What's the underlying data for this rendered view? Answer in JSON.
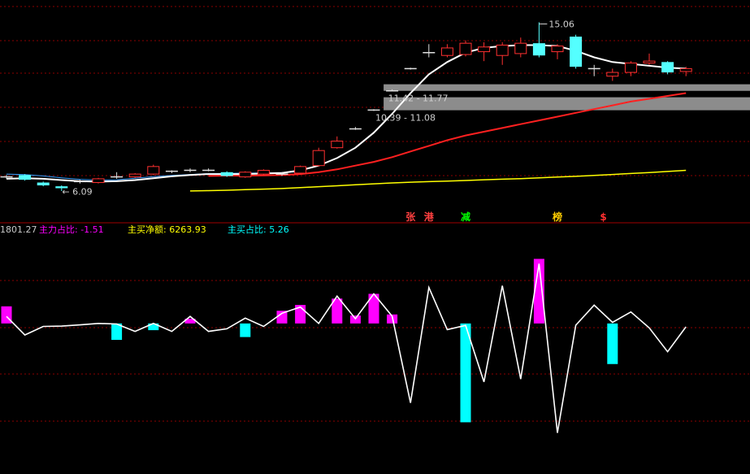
{
  "chart_data": [
    {
      "type": "candlestick",
      "price_ylim": [
        4.5,
        15.9
      ],
      "annotations": {
        "high_label": "15.06",
        "low_label": "6.09",
        "zone_upper_label": "11.42 - 11.77",
        "zone_lower_label": "10.39 - 11.08"
      },
      "zones": [
        {
          "low": 11.42,
          "high": 11.77
        },
        {
          "low": 10.39,
          "high": 11.08
        }
      ],
      "event_markers": [
        {
          "text": "张",
          "color": "#ff4040"
        },
        {
          "text": "港",
          "color": "#ff4040"
        },
        {
          "text": "减",
          "color": "#00ff00"
        },
        {
          "text": "榜",
          "color": "#ffcc00"
        },
        {
          "text": "$",
          "color": "#ff3030"
        }
      ],
      "candles": [
        {
          "o": 6.85,
          "c": 6.85,
          "h": 6.95,
          "l": 6.75,
          "up": true
        },
        {
          "o": 6.95,
          "c": 6.7,
          "h": 7.0,
          "l": 6.65,
          "up": false
        },
        {
          "o": 6.55,
          "c": 6.4,
          "h": 6.6,
          "l": 6.35,
          "up": false
        },
        {
          "o": 6.35,
          "c": 6.25,
          "h": 6.4,
          "l": 6.1,
          "up": false
        },
        {
          "o": 6.6,
          "c": 6.6,
          "h": 6.7,
          "l": 6.5,
          "up": true
        },
        {
          "o": 6.55,
          "c": 6.75,
          "h": 6.8,
          "l": 6.5,
          "up": true
        },
        {
          "o": 6.8,
          "c": 6.85,
          "h": 7.1,
          "l": 6.75,
          "up": true
        },
        {
          "o": 6.85,
          "c": 7.0,
          "h": 7.05,
          "l": 6.8,
          "up": true
        },
        {
          "o": 7.0,
          "c": 7.4,
          "h": 7.5,
          "l": 6.95,
          "up": true
        },
        {
          "o": 7.15,
          "c": 7.1,
          "h": 7.2,
          "l": 7.05,
          "up": false
        },
        {
          "o": 7.2,
          "c": 7.2,
          "h": 7.3,
          "l": 7.1,
          "up": true
        },
        {
          "o": 7.2,
          "c": 7.2,
          "h": 7.3,
          "l": 7.15,
          "up": true
        },
        {
          "o": 7.1,
          "c": 6.9,
          "h": 7.15,
          "l": 6.85,
          "up": false
        },
        {
          "o": 6.85,
          "c": 7.1,
          "h": 7.15,
          "l": 6.8,
          "up": true
        },
        {
          "o": 7.0,
          "c": 7.2,
          "h": 7.25,
          "l": 6.95,
          "up": true
        },
        {
          "o": 6.95,
          "c": 7.0,
          "h": 7.1,
          "l": 6.9,
          "up": true
        },
        {
          "o": 7.05,
          "c": 7.4,
          "h": 7.45,
          "l": 7.0,
          "up": true
        },
        {
          "o": 7.45,
          "c": 8.25,
          "h": 8.4,
          "l": 7.4,
          "up": true
        },
        {
          "o": 8.4,
          "c": 8.75,
          "h": 9.0,
          "l": 8.35,
          "up": true
        },
        {
          "o": 9.4,
          "c": 9.4,
          "h": 9.5,
          "l": 9.35,
          "up": true
        },
        {
          "o": 10.4,
          "c": 10.4,
          "h": 10.45,
          "l": 10.35,
          "up": true
        },
        {
          "o": 11.42,
          "c": 11.42,
          "h": 11.5,
          "l": 11.4,
          "up": true
        },
        {
          "o": 12.6,
          "c": 12.6,
          "h": 12.65,
          "l": 12.55,
          "up": true
        },
        {
          "o": 13.45,
          "c": 13.45,
          "h": 13.9,
          "l": 13.2,
          "up": false
        },
        {
          "o": 13.3,
          "c": 13.7,
          "h": 13.9,
          "l": 13.2,
          "up": true
        },
        {
          "o": 13.35,
          "c": 13.95,
          "h": 14.1,
          "l": 13.25,
          "up": true
        },
        {
          "o": 13.5,
          "c": 13.75,
          "h": 14.0,
          "l": 13.0,
          "up": true
        },
        {
          "o": 13.3,
          "c": 13.85,
          "h": 14.0,
          "l": 12.8,
          "up": true
        },
        {
          "o": 13.4,
          "c": 13.95,
          "h": 14.25,
          "l": 13.2,
          "up": true
        },
        {
          "o": 13.95,
          "c": 13.3,
          "h": 15.06,
          "l": 13.2,
          "up": false
        },
        {
          "o": 13.5,
          "c": 13.8,
          "h": 13.9,
          "l": 13.1,
          "up": true
        },
        {
          "o": 14.3,
          "c": 12.7,
          "h": 14.4,
          "l": 12.6,
          "up": false
        },
        {
          "o": 12.6,
          "c": 12.6,
          "h": 12.8,
          "l": 12.2,
          "up": false
        },
        {
          "o": 12.2,
          "c": 12.4,
          "h": 12.6,
          "l": 11.95,
          "up": true
        },
        {
          "o": 12.4,
          "c": 12.9,
          "h": 13.0,
          "l": 12.2,
          "up": true
        },
        {
          "o": 12.9,
          "c": 13.0,
          "h": 13.4,
          "l": 12.8,
          "up": true
        },
        {
          "o": 12.95,
          "c": 12.4,
          "h": 13.0,
          "l": 12.3,
          "up": false
        },
        {
          "o": 12.6,
          "c": 12.45,
          "h": 12.7,
          "l": 12.2,
          "up": true
        }
      ],
      "ma_white": [
        6.75,
        6.78,
        6.75,
        6.68,
        6.62,
        6.6,
        6.62,
        6.68,
        6.78,
        6.88,
        6.95,
        7.0,
        7.0,
        7.0,
        7.03,
        7.06,
        7.2,
        7.45,
        7.85,
        8.4,
        9.2,
        10.2,
        11.3,
        12.3,
        12.95,
        13.45,
        13.7,
        13.8,
        13.85,
        13.85,
        13.8,
        13.55,
        13.2,
        12.95,
        12.85,
        12.75,
        12.65,
        12.6
      ],
      "ma_red": [
        null,
        null,
        null,
        null,
        null,
        null,
        null,
        null,
        null,
        null,
        null,
        6.9,
        6.92,
        6.92,
        6.93,
        6.95,
        7.0,
        7.1,
        7.25,
        7.45,
        7.65,
        7.9,
        8.2,
        8.5,
        8.8,
        9.05,
        9.25,
        9.45,
        9.65,
        9.85,
        10.05,
        10.25,
        10.45,
        10.65,
        10.85,
        11.0,
        11.15,
        11.3
      ],
      "ma_yellow": [
        null,
        null,
        null,
        null,
        null,
        null,
        null,
        null,
        null,
        null,
        6.1,
        6.12,
        6.14,
        6.17,
        6.2,
        6.23,
        6.28,
        6.33,
        6.38,
        6.43,
        6.48,
        6.53,
        6.57,
        6.6,
        6.63,
        6.66,
        6.7,
        6.73,
        6.76,
        6.8,
        6.84,
        6.88,
        6.93,
        6.98,
        7.03,
        7.08,
        7.14,
        7.2
      ],
      "ma_blue": [
        7.0,
        6.97,
        6.9,
        6.8,
        6.72,
        6.68,
        6.7,
        6.78,
        6.86,
        6.93,
        6.98,
        7.02,
        7.04,
        7.05,
        7.06,
        7.08,
        7.12
      ]
    },
    {
      "type": "bar",
      "title_value": "1801.27",
      "legend": [
        {
          "label": "主力占比:",
          "value": "-1.51",
          "color": "#ff00ff"
        },
        {
          "label": "主买净额:",
          "value": "6263.93",
          "color": "#ffff00"
        },
        {
          "label": "主买占比:",
          "value": "5.26",
          "color": "#00ffff"
        }
      ],
      "ylim": [
        -8.3,
        4.6
      ],
      "bars": [
        0.97,
        0,
        0,
        0,
        0,
        0,
        -0.93,
        0,
        -0.38,
        0,
        0.27,
        0,
        0,
        -0.77,
        0,
        0.72,
        1.05,
        0,
        1.41,
        0.45,
        1.68,
        0.51,
        0,
        0,
        0,
        -5.6,
        0,
        0,
        0,
        3.66,
        0,
        0,
        0,
        -2.3,
        0,
        0,
        0,
        0
      ],
      "line": [
        0.4,
        -0.65,
        -0.17,
        -0.15,
        -0.08,
        0,
        -0.03,
        -0.45,
        0,
        -0.45,
        0.4,
        -0.45,
        -0.3,
        0.3,
        -0.17,
        0.58,
        0.93,
        0,
        1.55,
        0.27,
        1.68,
        0.41,
        -4.5,
        2.04,
        -0.35,
        -0.11,
        -3.31,
        2.14,
        -3.15,
        3.39,
        -6.2,
        -0.1,
        1.04,
        0.06,
        0.65,
        -0.25,
        -1.6,
        -0.19
      ]
    }
  ]
}
